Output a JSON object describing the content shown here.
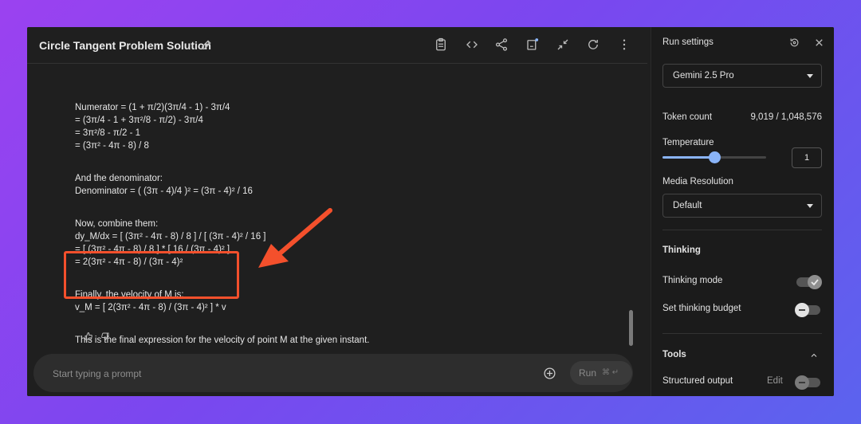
{
  "header": {
    "title": "Circle Tangent Problem Solution",
    "icons": [
      "edit-icon",
      "clipboard-icon",
      "code-icon",
      "share-icon",
      "compare-icon",
      "compress-icon",
      "refresh-icon",
      "more-icon"
    ]
  },
  "messages": {
    "lines": [
      "Numerator = (1 + π/2)(3π/4 - 1) - 3π/4",
      "= (3π/4 - 1 + 3π²/8 - π/2) - 3π/4",
      "= 3π²/8 - π/2 - 1",
      "= (3π² - 4π - 8) / 8",
      "And the denominator:",
      "Denominator = ( (3π - 4)/4 )² = (3π - 4)² / 16",
      "Now, combine them:",
      "dy_M/dx = [ (3π² - 4π - 8) / 8 ] / [ (3π - 4)² / 16 ]",
      "= [ (3π² - 4π - 8) / 8 ] * [ 16 / (3π - 4)² ]",
      "= 2(3π² - 4π - 8) / (3π - 4)²",
      "Finally, the velocity of M is:",
      "v_M = [ 2(3π² - 4π - 8) / (3π - 4)² ] * v",
      "This is the final expression for the velocity of point M at the given instant."
    ]
  },
  "prompt": {
    "placeholder": "Start typing a prompt",
    "run_label": "Run",
    "run_shortcut": "⌘ ↵"
  },
  "settings": {
    "title": "Run settings",
    "model": "Gemini 2.5 Pro",
    "token_count_label": "Token count",
    "token_count_value": "9,019 / 1,048,576",
    "temperature_label": "Temperature",
    "temperature_value": "1",
    "temperature_fraction": 0.5,
    "media_resolution_label": "Media Resolution",
    "media_resolution_value": "Default",
    "thinking_heading": "Thinking",
    "thinking_mode_label": "Thinking mode",
    "thinking_mode_on": true,
    "thinking_budget_label": "Set thinking budget",
    "thinking_budget_on": false,
    "tools_heading": "Tools",
    "structured_output_label": "Structured output",
    "structured_output_edit": "Edit",
    "structured_output_on": false
  },
  "colors": {
    "accent": "#8ab4f8",
    "highlight": "#f4502c"
  }
}
